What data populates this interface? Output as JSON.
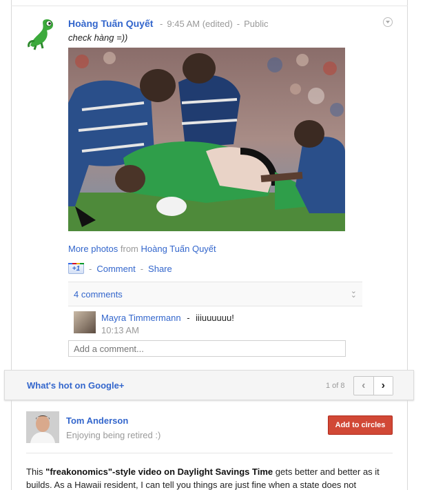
{
  "post": {
    "author": "Hoàng Tuấn Quyết",
    "time": "9:45 AM (edited)",
    "visibility": "Public",
    "text": "check hàng =))",
    "more_photos_label": "More photos",
    "from_label": "from",
    "from_author": "Hoàng Tuấn Quyết",
    "plus_one_label": "+1",
    "comment_action": "Comment",
    "share_action": "Share",
    "separator": "-",
    "comments_count": "4 comments",
    "add_comment_placeholder": "Add a comment..."
  },
  "comment": {
    "author": "Mayra Timmermann",
    "text": "iiiuuuuuu!",
    "separator": "-",
    "time": "10:13 AM"
  },
  "whats_hot": {
    "title": "What's hot on Google+",
    "page": "1 of 8",
    "prev_icon": "chevron-left-icon",
    "next_icon": "chevron-right-icon"
  },
  "hot_post": {
    "author": "Tom Anderson",
    "status": "Enjoying being retired :)",
    "add_button": "Add to circles",
    "text_bold_1": "This ",
    "text_quote": "\"freakonomics\"-style video on Daylight Savings Time",
    "text_rest": " gets better and better as it builds. As a Hawaii resident, I can tell you things are just fine when a state does not"
  },
  "colors": {
    "link": "#3366cc",
    "meta": "#999999",
    "add_circles": "#d14836",
    "jersey_green": "#2f9e4a",
    "jersey_blue": "#2a4f8a"
  }
}
